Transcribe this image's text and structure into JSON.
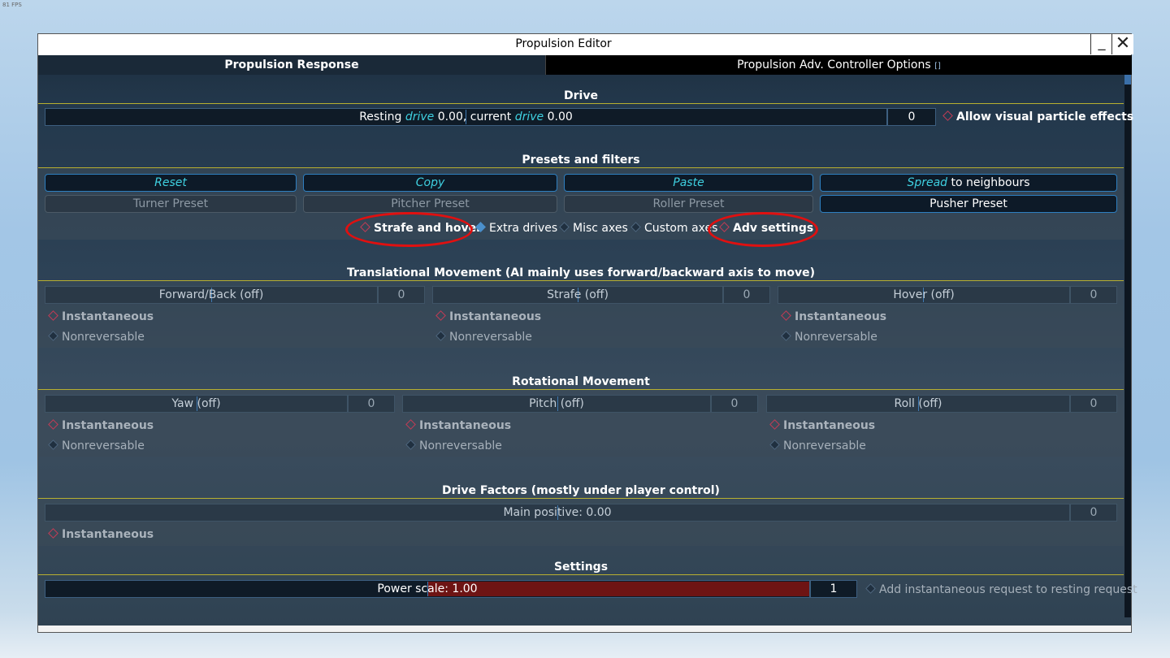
{
  "overlay": {
    "fps": "81 FPS"
  },
  "window": {
    "title": "Propulsion Editor",
    "minimize_glyph": "_",
    "close_glyph": "✕"
  },
  "tabs": [
    {
      "label": "Propulsion Response",
      "active": true
    },
    {
      "label": "Propulsion Adv. Controller Options",
      "marker": "[]",
      "active": false
    }
  ],
  "drive": {
    "title": "Drive",
    "text_pre1": "Resting ",
    "word": "drive",
    "text_mid": " 0.00, current ",
    "text_post": " 0.00",
    "value": "0",
    "particle_toggle": "Allow visual particle effects"
  },
  "presets": {
    "title": "Presets and filters",
    "reset": "Reset",
    "copy": "Copy",
    "paste": "Paste",
    "spread_word": "Spread",
    "spread_rest": " to neighbours",
    "turner": "Turner Preset",
    "pitcher": "Pitcher Preset",
    "roller": "Roller Preset",
    "pusher": "Pusher Preset",
    "filters": [
      "Strafe and hover",
      "Extra drives",
      "Misc axes",
      "Custom axes",
      "Adv settings"
    ]
  },
  "translational": {
    "title": "Translational Movement (AI mainly uses forward/backward axis to move)",
    "axes": [
      {
        "label": "Forward/Back (off)",
        "value": "0"
      },
      {
        "label": "Strafe (off)",
        "value": "0"
      },
      {
        "label": "Hover (off)",
        "value": "0"
      }
    ],
    "instantaneous": "Instantaneous",
    "nonreversable": "Nonreversable"
  },
  "rotational": {
    "title": "Rotational Movement",
    "axes": [
      {
        "label": "Yaw (off)",
        "value": "0"
      },
      {
        "label": "Pitch (off)",
        "value": "0"
      },
      {
        "label": "Roll (off)",
        "value": "0"
      }
    ],
    "instantaneous": "Instantaneous",
    "nonreversable": "Nonreversable"
  },
  "factors": {
    "title": "Drive Factors (mostly under player control)",
    "main_positive": "Main positive: 0.00",
    "value": "0",
    "instantaneous": "Instantaneous"
  },
  "settings": {
    "title": "Settings",
    "power_scale": "Power scale: 1.00",
    "power_fill_fraction": 0.5,
    "value": "1",
    "add_request": "Add instantaneous request to resting request"
  },
  "colors": {
    "accent": "#3fd0e0",
    "highlight_ring": "#e01010",
    "power_fill": "#6e1414",
    "section_line": "#b8b030"
  }
}
